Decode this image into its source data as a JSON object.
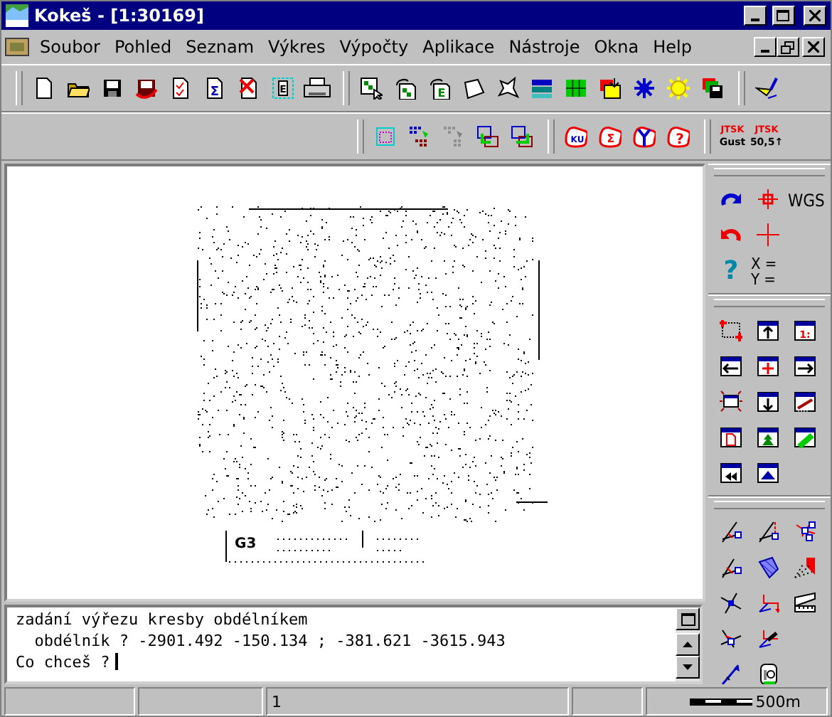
{
  "window": {
    "title": "Kokeš - [1:30169]"
  },
  "menu": [
    "Soubor",
    "Pohled",
    "Seznam",
    "Výkres",
    "Výpočty",
    "Aplikace",
    "Nástroje",
    "Okna",
    "Help"
  ],
  "icon_texts": {
    "sigma": "Σ",
    "export": "E",
    "frame_export": "E",
    "region_ku": "KU",
    "region_sigma": "Σ",
    "region_question": "?",
    "scale_window": "1:",
    "help": "?"
  },
  "jtsk_buttons": [
    {
      "top": "JTSK",
      "bottom": "Gust"
    },
    {
      "top": "JTSK",
      "bottom": "50,5↑"
    }
  ],
  "coordinates": {
    "system": "WGS",
    "x": "X =",
    "y": "Y ="
  },
  "map": {
    "legend_mark": "G3"
  },
  "console": {
    "lines": [
      "zadání výřezu kresby obdélníkem",
      "  obdélník ? -2901.492 -150.134 ; -381.621 -3615.943"
    ],
    "prompt": "Co chceš ?"
  },
  "status_bar": {
    "page": "1",
    "scale": "500m"
  }
}
